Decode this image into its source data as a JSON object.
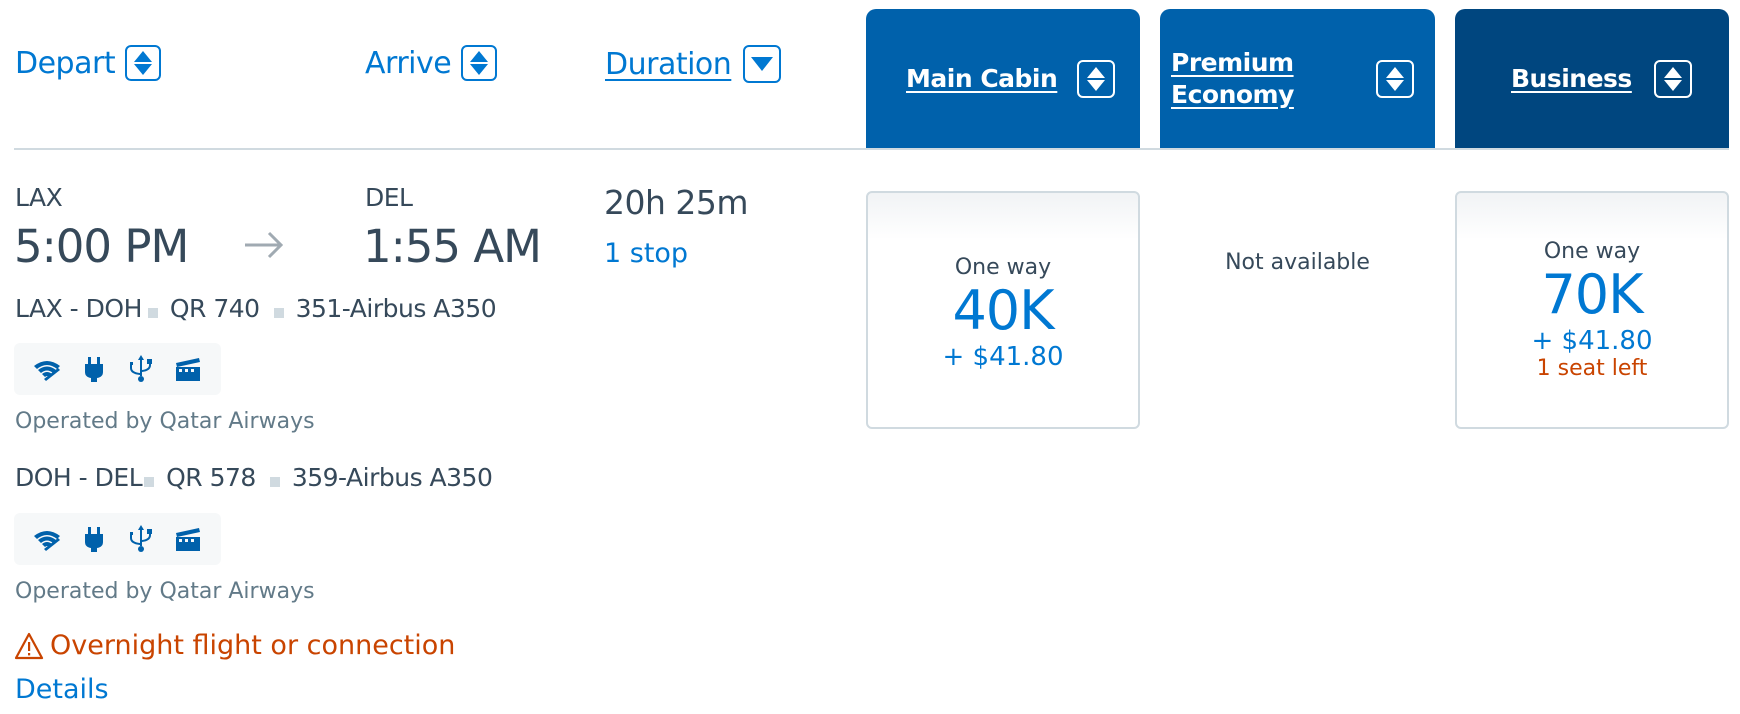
{
  "header": {
    "depart_label": "Depart",
    "arrive_label": "Arrive",
    "duration_label": "Duration",
    "cabins": [
      {
        "label": "Main Cabin"
      },
      {
        "label_line1": "Premium",
        "label_line2": "Economy"
      },
      {
        "label": "Business"
      }
    ]
  },
  "flight": {
    "origin_code": "LAX",
    "depart_time": "5:00 PM",
    "dest_code": "DEL",
    "arrive_time": "1:55 AM",
    "arrow_icon": "→",
    "duration": "20h 25m",
    "stops": "1 stop",
    "segments": [
      {
        "route": "LAX - DOH",
        "flight_no": "QR 740",
        "aircraft": "351-Airbus A350",
        "amenities": [
          "wifi-icon",
          "power-outlet-icon",
          "usb-icon",
          "entertainment-icon"
        ],
        "operated_by": "Operated by Qatar Airways"
      },
      {
        "route": "DOH - DEL",
        "flight_no": "QR 578",
        "aircraft": "359-Airbus A350",
        "amenities": [
          "wifi-icon",
          "power-outlet-icon",
          "usb-icon",
          "entertainment-icon"
        ],
        "operated_by": "Operated by Qatar Airways"
      }
    ],
    "warning": "Overnight flight or connection",
    "warning_icon": "⚠",
    "details_link": "Details"
  },
  "fares": {
    "main_cabin": {
      "label": "One way",
      "miles": "40K",
      "fee": "+ $41.80"
    },
    "premium_economy": {
      "status": "Not available"
    },
    "business": {
      "label": "One way",
      "miles": "70K",
      "fee": "+ $41.80",
      "seats_left": "1 seat left"
    }
  },
  "colors": {
    "link_blue": "#0078d2",
    "cabin_header_blue": "#0061ab",
    "business_header_navy": "#00467f",
    "text_dark": "#36495a",
    "warning_orange": "#c94400"
  }
}
